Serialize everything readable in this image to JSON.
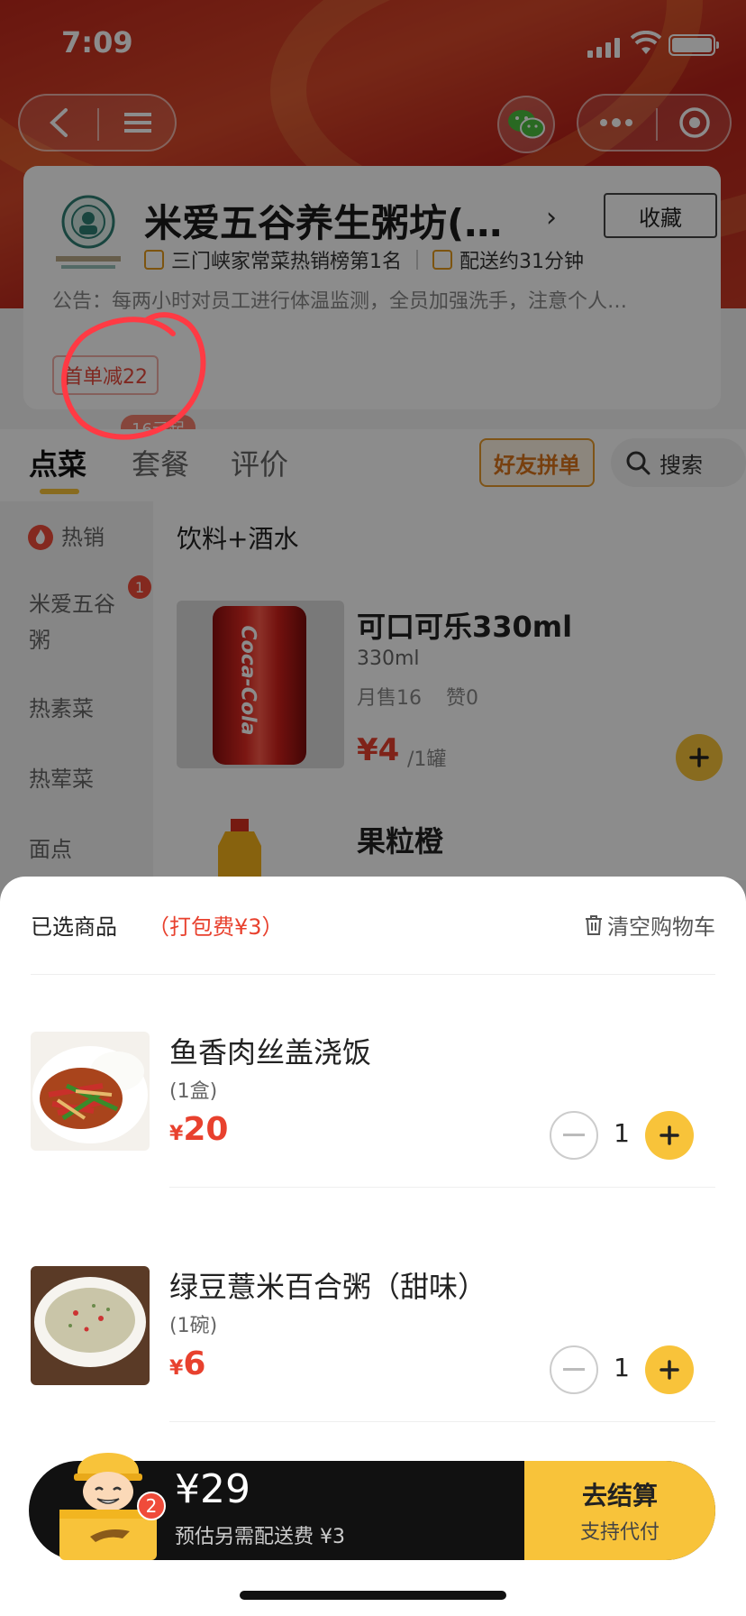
{
  "status_bar": {
    "time": "7:09"
  },
  "store": {
    "name": "米爱五谷养生粥坊(…",
    "favorite_label": "收藏",
    "ranking": "三门峡家常菜热销榜第1名",
    "delivery_time": "配送约31分钟",
    "notice": "公告：每两小时对员工进行体温监测，全员加强洗手，注意个人…",
    "coupon": "首单减22",
    "min_order": "16元起"
  },
  "tabs": [
    {
      "label": "点菜"
    },
    {
      "label": "套餐"
    },
    {
      "label": "评价"
    }
  ],
  "group_order_label": "好友拼单",
  "search_label": "搜索",
  "categories": [
    {
      "label": "热销"
    },
    {
      "label": "米爱五谷粥",
      "badge": "1"
    },
    {
      "label": "热素菜"
    },
    {
      "label": "热荤菜"
    },
    {
      "label": "面点"
    }
  ],
  "menu": {
    "section_title": "饮料+酒水",
    "products": [
      {
        "name": "可口可乐330ml",
        "spec": "330ml",
        "sales": "月售16",
        "likes": "赞0",
        "price": "¥4",
        "unit": "/1罐"
      },
      {
        "name": "果粒橙"
      }
    ]
  },
  "cart": {
    "header": "已选商品",
    "packing_fee": "（打包费¥3）",
    "clear_label": "清空购物车",
    "items": [
      {
        "name": "鱼香肉丝盖浇饭",
        "unit": "(1盒)",
        "currency": "¥",
        "price": "20",
        "qty": "1"
      },
      {
        "name": "绿豆薏米百合粥（甜味）",
        "unit": "(1碗)",
        "currency": "¥",
        "price": "6",
        "qty": "1"
      }
    ],
    "count_badge": "2",
    "total": "¥29",
    "delivery_note": "预估另需配送费 ¥3",
    "checkout_label": "去结算",
    "checkout_sub": "支持代付"
  },
  "colors": {
    "accent": "#f8c33a",
    "price": "#e8412e",
    "header_red": "#c0281c"
  }
}
